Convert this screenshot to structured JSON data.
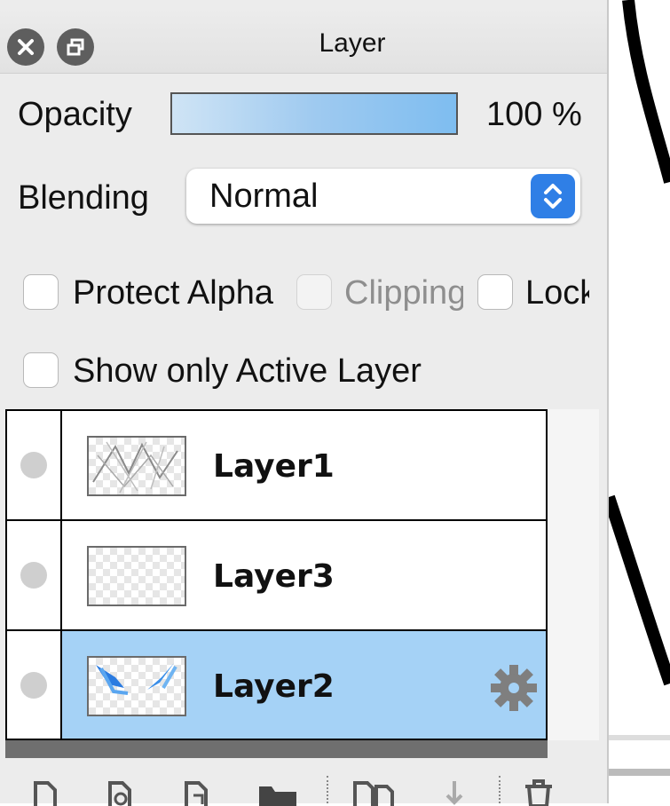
{
  "panel": {
    "title": "Layer",
    "opacity": {
      "label": "Opacity",
      "value_text": "100 %",
      "fraction": 1.0
    },
    "blending": {
      "label": "Blending",
      "selected": "Normal"
    },
    "checkboxes": [
      {
        "label": "Protect Alpha",
        "checked": false,
        "enabled": true
      },
      {
        "label": "Clipping",
        "checked": false,
        "enabled": false
      },
      {
        "label": "Lock",
        "checked": false,
        "enabled": true
      }
    ],
    "show_only_active": {
      "label": "Show only Active Layer",
      "checked": false
    },
    "layers": [
      {
        "name": "Layer1",
        "selected": false,
        "thumb": "sketch-lines"
      },
      {
        "name": "Layer3",
        "selected": false,
        "thumb": "empty"
      },
      {
        "name": "Layer2",
        "selected": true,
        "thumb": "blue-strokes"
      }
    ],
    "toolbar_icons": [
      "new-layer-icon",
      "new-layer-copy-icon",
      "new-layer-alt-icon",
      "folder-icon",
      "duplicate-layer-icon",
      "merge-down-icon",
      "trash-icon"
    ]
  },
  "colors": {
    "selection": "#a5d2f6",
    "accent": "#2f7fe6",
    "close_red": "#e8231b"
  }
}
